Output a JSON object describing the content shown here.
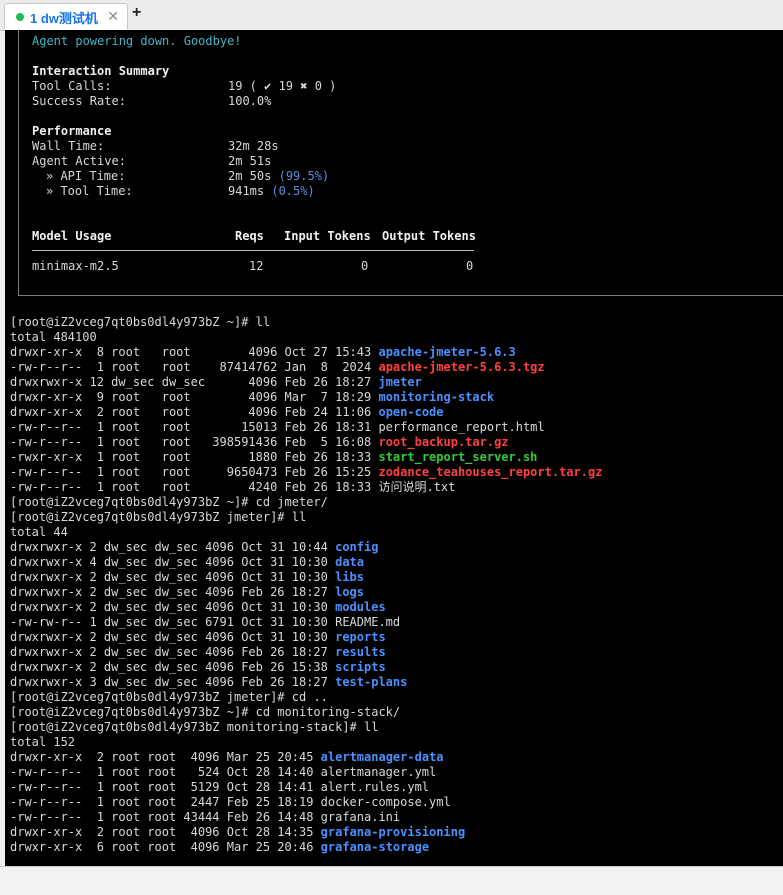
{
  "tab": {
    "label": "1 dw测试机",
    "close": "✕",
    "status_color": "#1db954"
  },
  "new_tab": "+",
  "summary": {
    "goodbye": "Agent powering down. Goodbye!",
    "interaction_title": "Interaction Summary",
    "tool_calls_label": "Tool Calls:",
    "tool_calls_value": "19 ( ✔ 19 ✖ 0 )",
    "success_label": "Success Rate:",
    "success_value": "100.0%",
    "performance_title": "Performance",
    "wall_label": "Wall Time:",
    "wall_value": "32m 28s",
    "active_label": "Agent Active:",
    "active_value": "2m 51s",
    "api_label": "» API Time:",
    "api_value": "2m 50s",
    "api_pct": "(99.5%)",
    "tool_label": "» Tool Time:",
    "tool_value": "941ms",
    "tool_pct": "(0.5%)",
    "model_headers": [
      "Model Usage",
      "Reqs",
      "Input Tokens",
      "Output Tokens"
    ],
    "model_row": [
      "minimax-m2.5",
      "12",
      "0",
      "0"
    ]
  },
  "lines": [
    [
      {
        "t": "[root@iZ2vceg7qt0bs0dl4y973bZ ~]# ll"
      }
    ],
    [
      {
        "t": "total 484100"
      }
    ],
    [
      {
        "t": "drwxr-xr-x  8 root   root        4096 Oct 27 15:43 "
      },
      {
        "t": "apache-jmeter-5.6.3",
        "c": "dir"
      }
    ],
    [
      {
        "t": "-rw-r--r--  1 root   root    87414762 Jan  8  2024 "
      },
      {
        "t": "apache-jmeter-5.6.3.tgz",
        "c": "arc"
      }
    ],
    [
      {
        "t": "drwxrwxr-x 12 dw_sec dw_sec      4096 Feb 26 18:27 "
      },
      {
        "t": "jmeter",
        "c": "dir"
      }
    ],
    [
      {
        "t": "drwxr-xr-x  9 root   root        4096 Mar  7 18:29 "
      },
      {
        "t": "monitoring-stack",
        "c": "dir"
      }
    ],
    [
      {
        "t": "drwxr-xr-x  2 root   root        4096 Feb 24 11:06 "
      },
      {
        "t": "open-code",
        "c": "dir"
      }
    ],
    [
      {
        "t": "-rw-r--r--  1 root   root       15013 Feb 26 18:31 performance_report.html"
      }
    ],
    [
      {
        "t": "-rw-r--r--  1 root   root   398591436 Feb  5 16:08 "
      },
      {
        "t": "root_backup.tar.gz",
        "c": "arc"
      }
    ],
    [
      {
        "t": "-rwxr-xr-x  1 root   root        1880 Feb 26 18:33 "
      },
      {
        "t": "start_report_server.sh",
        "c": "exe"
      }
    ],
    [
      {
        "t": "-rw-r--r--  1 root   root     9650473 Feb 26 15:25 "
      },
      {
        "t": "zodance_teahouses_report.tar.gz",
        "c": "arc"
      }
    ],
    [
      {
        "t": "-rw-r--r--  1 root   root        4240 Feb 26 18:33 访问说明.txt"
      }
    ],
    [
      {
        "t": "[root@iZ2vceg7qt0bs0dl4y973bZ ~]# cd jmeter/"
      }
    ],
    [
      {
        "t": "[root@iZ2vceg7qt0bs0dl4y973bZ jmeter]# ll"
      }
    ],
    [
      {
        "t": "total 44"
      }
    ],
    [
      {
        "t": "drwxrwxr-x 2 dw_sec dw_sec 4096 Oct 31 10:44 "
      },
      {
        "t": "config",
        "c": "dir"
      }
    ],
    [
      {
        "t": "drwxrwxr-x 4 dw_sec dw_sec 4096 Oct 31 10:30 "
      },
      {
        "t": "data",
        "c": "dir"
      }
    ],
    [
      {
        "t": "drwxrwxr-x 2 dw_sec dw_sec 4096 Oct 31 10:30 "
      },
      {
        "t": "libs",
        "c": "dir"
      }
    ],
    [
      {
        "t": "drwxrwxr-x 2 dw_sec dw_sec 4096 Feb 26 18:27 "
      },
      {
        "t": "logs",
        "c": "dir"
      }
    ],
    [
      {
        "t": "drwxrwxr-x 2 dw_sec dw_sec 4096 Oct 31 10:30 "
      },
      {
        "t": "modules",
        "c": "dir"
      }
    ],
    [
      {
        "t": "-rw-rw-r-- 1 dw_sec dw_sec 6791 Oct 31 10:30 README.md"
      }
    ],
    [
      {
        "t": "drwxrwxr-x 2 dw_sec dw_sec 4096 Oct 31 10:30 "
      },
      {
        "t": "reports",
        "c": "dir"
      }
    ],
    [
      {
        "t": "drwxrwxr-x 2 dw_sec dw_sec 4096 Feb 26 18:27 "
      },
      {
        "t": "results",
        "c": "dir"
      }
    ],
    [
      {
        "t": "drwxrwxr-x 2 dw_sec dw_sec 4096 Feb 26 15:38 "
      },
      {
        "t": "scripts",
        "c": "dir"
      }
    ],
    [
      {
        "t": "drwxrwxr-x 3 dw_sec dw_sec 4096 Feb 26 18:27 "
      },
      {
        "t": "test-plans",
        "c": "dir"
      }
    ],
    [
      {
        "t": "[root@iZ2vceg7qt0bs0dl4y973bZ jmeter]# cd .."
      }
    ],
    [
      {
        "t": "[root@iZ2vceg7qt0bs0dl4y973bZ ~]# cd monitoring-stack/"
      }
    ],
    [
      {
        "t": "[root@iZ2vceg7qt0bs0dl4y973bZ monitoring-stack]# ll"
      }
    ],
    [
      {
        "t": "total 152"
      }
    ],
    [
      {
        "t": "drwxr-xr-x  2 root root  4096 Mar 25 20:45 "
      },
      {
        "t": "alertmanager-data",
        "c": "dir"
      }
    ],
    [
      {
        "t": "-rw-r--r--  1 root root   524 Oct 28 14:40 alertmanager.yml"
      }
    ],
    [
      {
        "t": "-rw-r--r--  1 root root  5129 Oct 28 14:41 alert.rules.yml"
      }
    ],
    [
      {
        "t": "-rw-r--r--  1 root root  2447 Feb 25 18:19 docker-compose.yml"
      }
    ],
    [
      {
        "t": "-rw-r--r--  1 root root 43444 Feb 26 14:48 grafana.ini"
      }
    ],
    [
      {
        "t": "drwxr-xr-x  2 root root  4096 Oct 28 14:35 "
      },
      {
        "t": "grafana-provisioning",
        "c": "dir"
      }
    ],
    [
      {
        "t": "drwxr-xr-x  6 root root  4096 Mar 25 20:46 "
      },
      {
        "t": "grafana-storage",
        "c": "dir"
      }
    ]
  ]
}
